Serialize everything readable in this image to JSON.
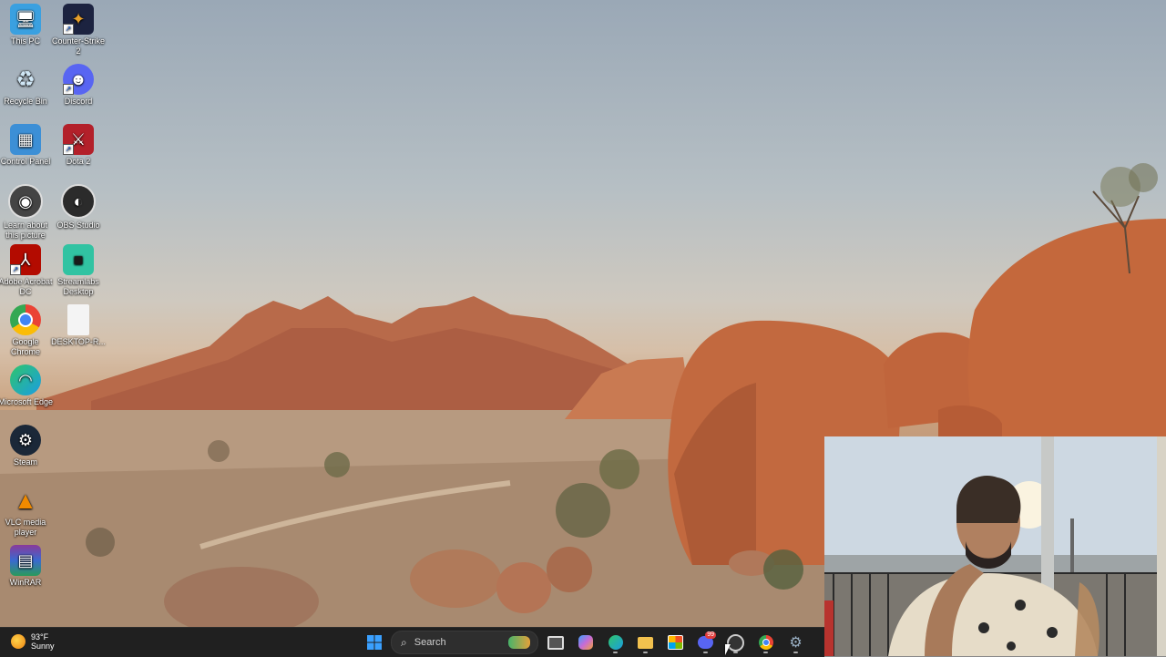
{
  "desktop_icons": [
    {
      "label": "This PC",
      "icon": "computer-icon",
      "color": "#3aa0e0"
    },
    {
      "label": "Counter-Strike 2",
      "icon": "cs2-icon",
      "color": "#e59f2b"
    },
    {
      "label": "Recycle Bin",
      "icon": "recycle-bin-icon",
      "color": "#8fb3c9"
    },
    {
      "label": "Discord",
      "icon": "discord-icon",
      "color": "#5865f2"
    },
    {
      "label": "Control Panel",
      "icon": "control-panel-icon",
      "color": "#3c8fd6"
    },
    {
      "label": "Dota 2",
      "icon": "dota2-icon",
      "color": "#b3202a"
    },
    {
      "label": "Learn about this picture",
      "icon": "camera-icon",
      "color": "#444444"
    },
    {
      "label": "OBS Studio",
      "icon": "obs-icon",
      "color": "#2b2b2b"
    },
    {
      "label": "Adobe Acrobat DC",
      "icon": "acrobat-icon",
      "color": "#b30b00"
    },
    {
      "label": "Streamlabs Desktop",
      "icon": "streamlabs-icon",
      "color": "#31c3a2"
    },
    {
      "label": "Google Chrome",
      "icon": "chrome-icon",
      "color": "#4285f4"
    },
    {
      "label": "DESKTOP-R...",
      "icon": "file-icon",
      "color": "#f1f1f1"
    },
    {
      "label": "Microsoft Edge",
      "icon": "edge-icon",
      "color": "#1b9de2"
    },
    {
      "label": "Steam",
      "icon": "steam-icon",
      "color": "#1b2838"
    },
    {
      "label": "VLC media player",
      "icon": "vlc-icon",
      "color": "#f08a00"
    },
    {
      "label": "WinRAR",
      "icon": "winrar-icon",
      "color": "#8a3a9a"
    }
  ],
  "weather": {
    "temp": "93°F",
    "condition": "Sunny"
  },
  "taskbar": {
    "search_placeholder": "Search",
    "apps": [
      {
        "name": "start-button",
        "icon": "windows-icon",
        "color": "#3aa0ff"
      },
      {
        "name": "task-view-button",
        "icon": "task-view-icon",
        "color": "#dddddd"
      },
      {
        "name": "copilot-button",
        "icon": "copilot-icon",
        "color": "#c76bd6"
      },
      {
        "name": "edge-button",
        "icon": "edge-icon",
        "color": "#1b9de2"
      },
      {
        "name": "file-explorer-button",
        "icon": "folder-icon",
        "color": "#f2c14e"
      },
      {
        "name": "store-button",
        "icon": "store-icon",
        "color": "#ffffff"
      },
      {
        "name": "discord-button",
        "icon": "discord-icon",
        "color": "#5865f2",
        "badge": "99"
      },
      {
        "name": "obs-button",
        "icon": "obs-icon",
        "color": "#cccccc"
      },
      {
        "name": "chrome-button",
        "icon": "chrome-icon",
        "color": "#4285f4"
      },
      {
        "name": "settings-button",
        "icon": "gear-icon",
        "color": "#9ab0c4"
      }
    ]
  }
}
